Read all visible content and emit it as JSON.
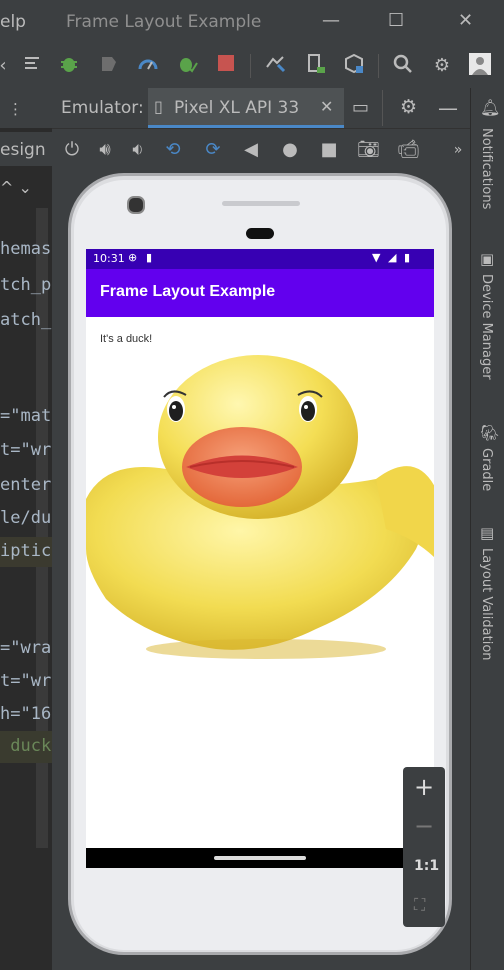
{
  "titlebar": {
    "menu_label": "elp",
    "window_title": "Frame Layout Example",
    "minimize": "—",
    "maximize": "☐",
    "close": "✕"
  },
  "editor": {
    "design_tab": "esign",
    "lines": [
      "hemas",
      "tch_p",
      "atch_",
      "=\"mat",
      "t=\"wr",
      "enter",
      "le/du",
      "iptic",
      "=\"wra",
      "t=\"wr",
      "h=\"16",
      " duck"
    ]
  },
  "emulator": {
    "label": "Emulator:",
    "device_tab": "Pixel XL API 33",
    "close_tab": "✕"
  },
  "sidebar": {
    "items": [
      "Notifications",
      "Device Manager",
      "Gradle",
      "Layout Validation"
    ]
  },
  "device": {
    "status_time": "10:31",
    "app_title": "Frame Layout Example",
    "text_view": "It's a duck!"
  },
  "zoom": {
    "plus": "+",
    "minus": "−",
    "one_to_one": "1:1"
  },
  "colors": {
    "status_bar": "#3700b3",
    "app_bar": "#6200ee",
    "ide_bg": "#3c3f41"
  }
}
